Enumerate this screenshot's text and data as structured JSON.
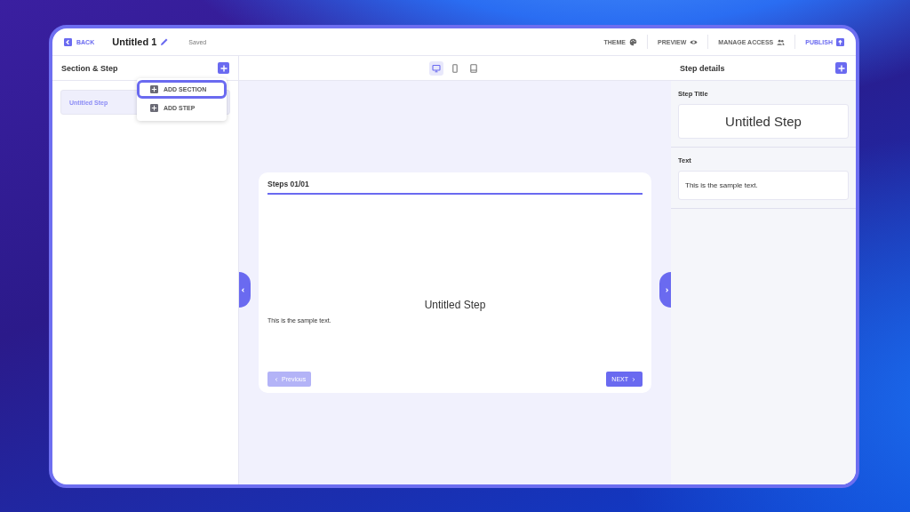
{
  "header": {
    "back": "BACK",
    "title": "Untitled 1",
    "status": "Saved",
    "actions": [
      {
        "label": "THEME",
        "kind": "theme"
      },
      {
        "label": "PREVIEW",
        "kind": "preview"
      },
      {
        "label": "MANAGE ACCESS",
        "kind": "access"
      },
      {
        "label": "PUBLISH",
        "kind": "publish"
      }
    ]
  },
  "left_panel": {
    "title": "Section & Step",
    "steps": [
      {
        "label": "Untitled Step",
        "selected": true
      }
    ],
    "menu": [
      {
        "label": "ADD SECTION",
        "selected": true
      },
      {
        "label": "ADD STEP",
        "selected": false
      }
    ]
  },
  "devices": [
    {
      "kind": "desktop",
      "selected": true
    },
    {
      "kind": "phone",
      "selected": false
    },
    {
      "kind": "tablet",
      "selected": false
    }
  ],
  "preview": {
    "progress_label": "Steps 01/01",
    "level": 1,
    "title": "Untitled Step",
    "text": "This is the sample text.",
    "previous": {
      "label": "Previous",
      "disabled": true
    },
    "next": {
      "label": "NEXT",
      "disabled": false
    }
  },
  "right_panel": {
    "title": "Step details",
    "fields": [
      {
        "label": "Step Title",
        "value": "Untitled Step",
        "kind": "title"
      },
      {
        "label": "Text",
        "value": "This is the sample text.",
        "kind": "text"
      }
    ]
  }
}
